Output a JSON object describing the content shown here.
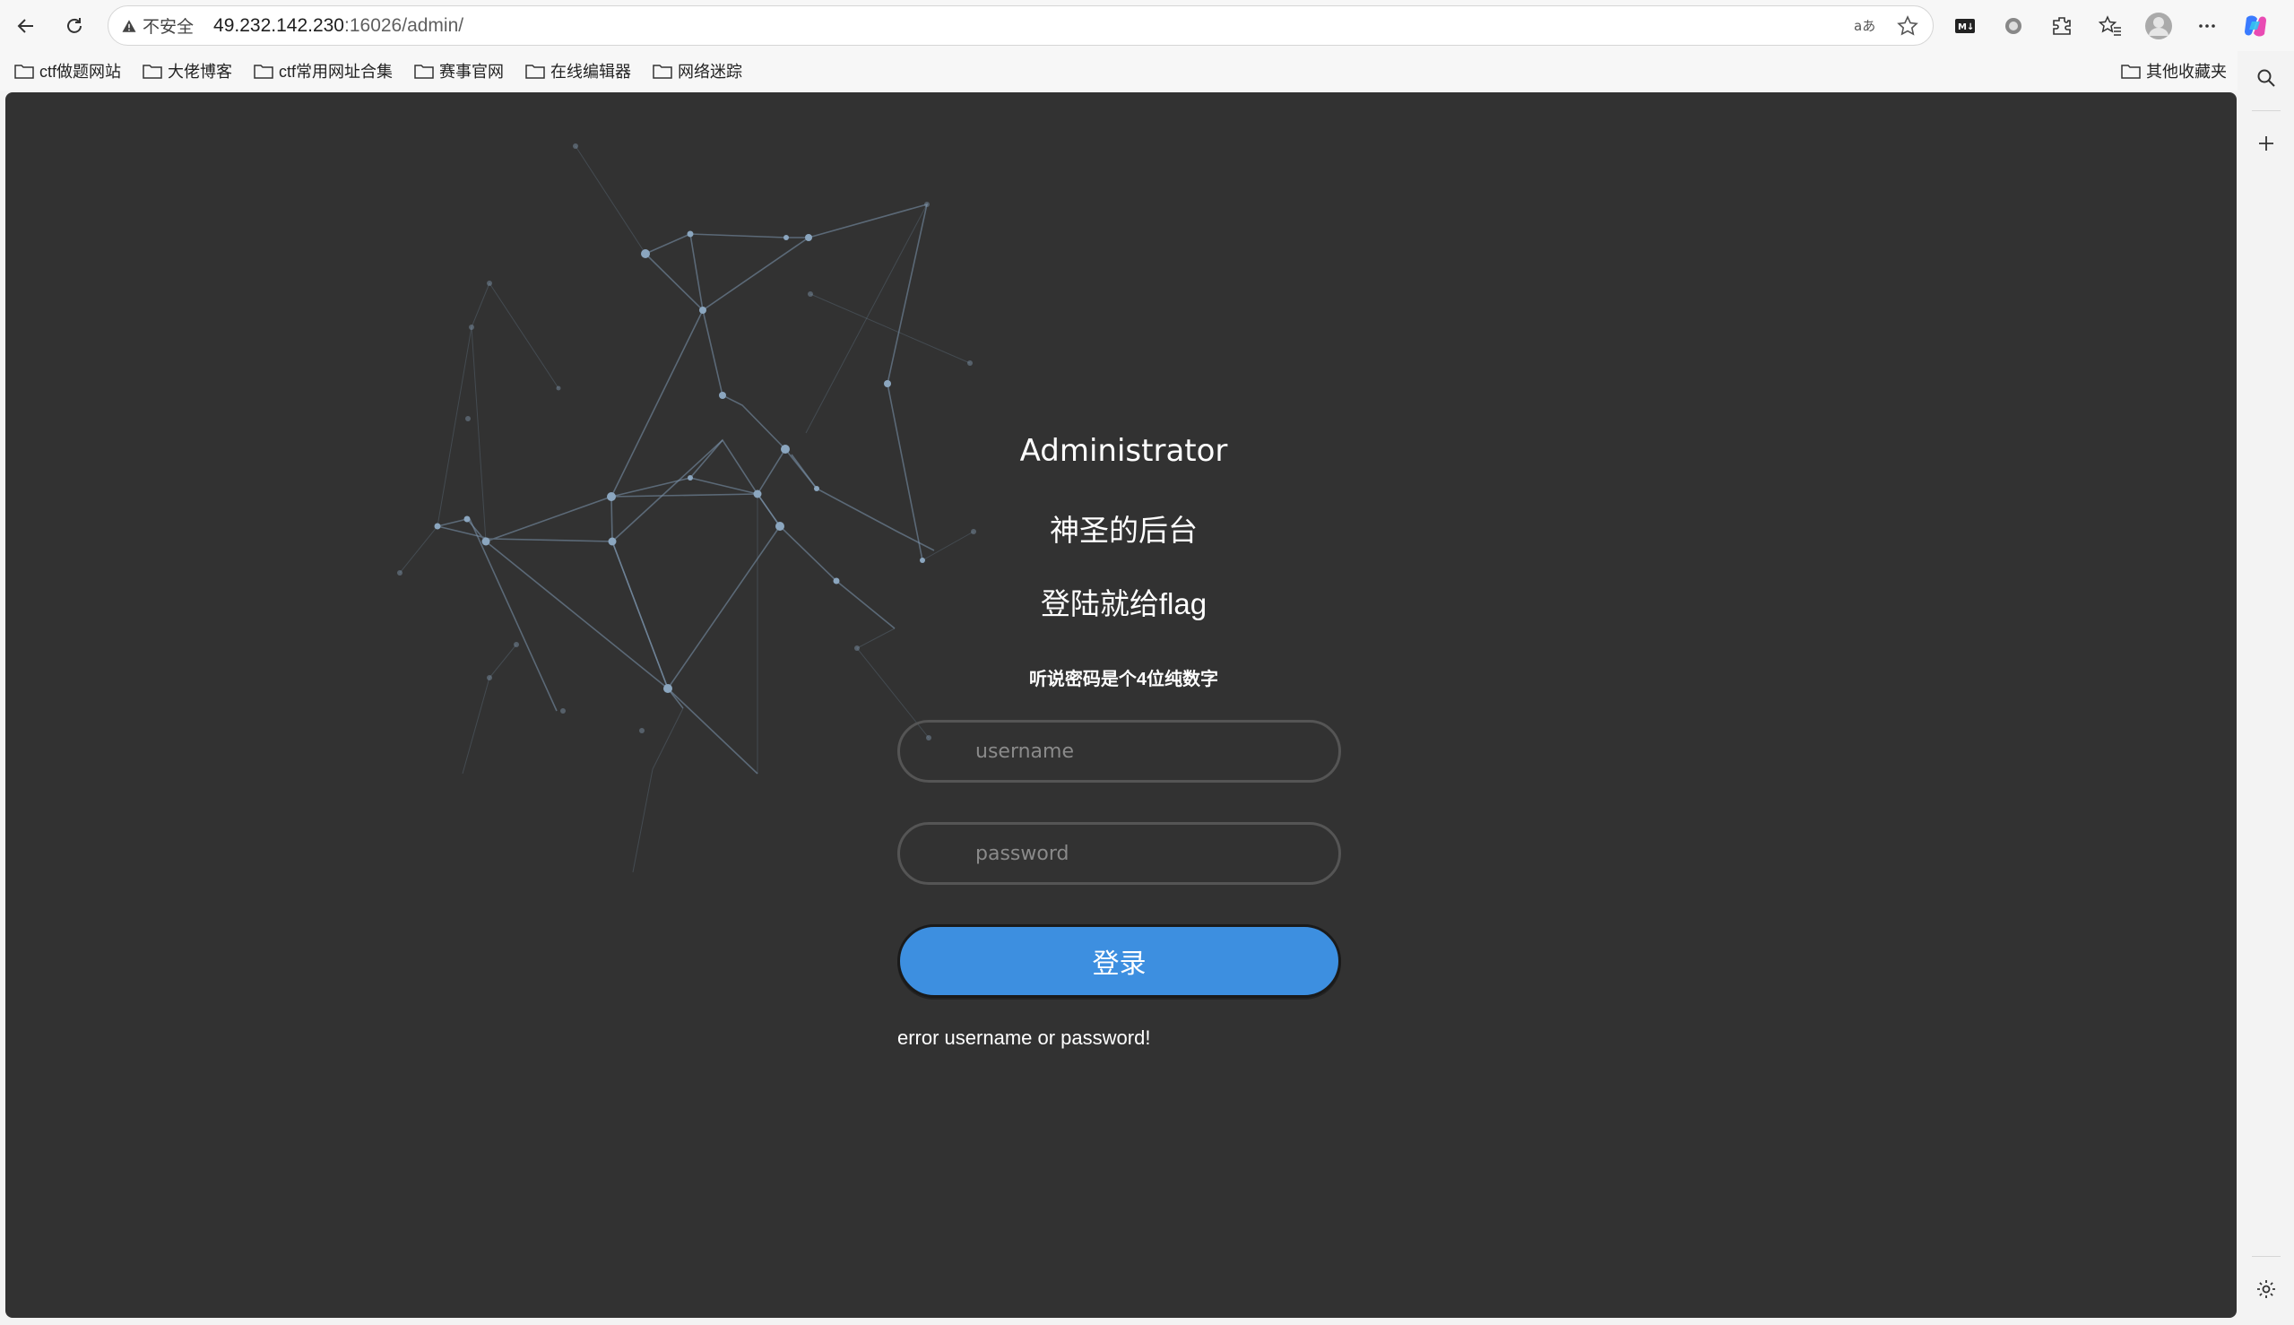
{
  "browser": {
    "security_label": "不安全",
    "url_host": "49.232.142.230",
    "url_path": ":16026/admin/"
  },
  "bookmarks": [
    {
      "label": "ctf做题网站"
    },
    {
      "label": "大佬博客"
    },
    {
      "label": "ctf常用网址合集"
    },
    {
      "label": "赛事官网"
    },
    {
      "label": "在线编辑器"
    },
    {
      "label": "网络迷踪"
    }
  ],
  "bookmarks_other": "其他收藏夹",
  "page": {
    "title": "Administrator",
    "subtitle1": "神圣的后台",
    "subtitle2": "登陆就给flag",
    "hint": "听说密码是个4位纯数字",
    "username_placeholder": "username",
    "password_placeholder": "password",
    "login_label": "登录",
    "error": "error username or password!"
  },
  "colors": {
    "background": "#323232",
    "button": "#3d8fe0",
    "network": "#7d98b0"
  },
  "icons": [
    "back-icon",
    "refresh-icon",
    "warning-icon",
    "translate-icon",
    "star-icon",
    "markdown-icon",
    "record-icon",
    "extension-icon",
    "favorites-icon",
    "profile-icon",
    "more-icon",
    "copilot-icon",
    "search-icon",
    "plus-icon",
    "settings-icon",
    "folder-icon"
  ]
}
